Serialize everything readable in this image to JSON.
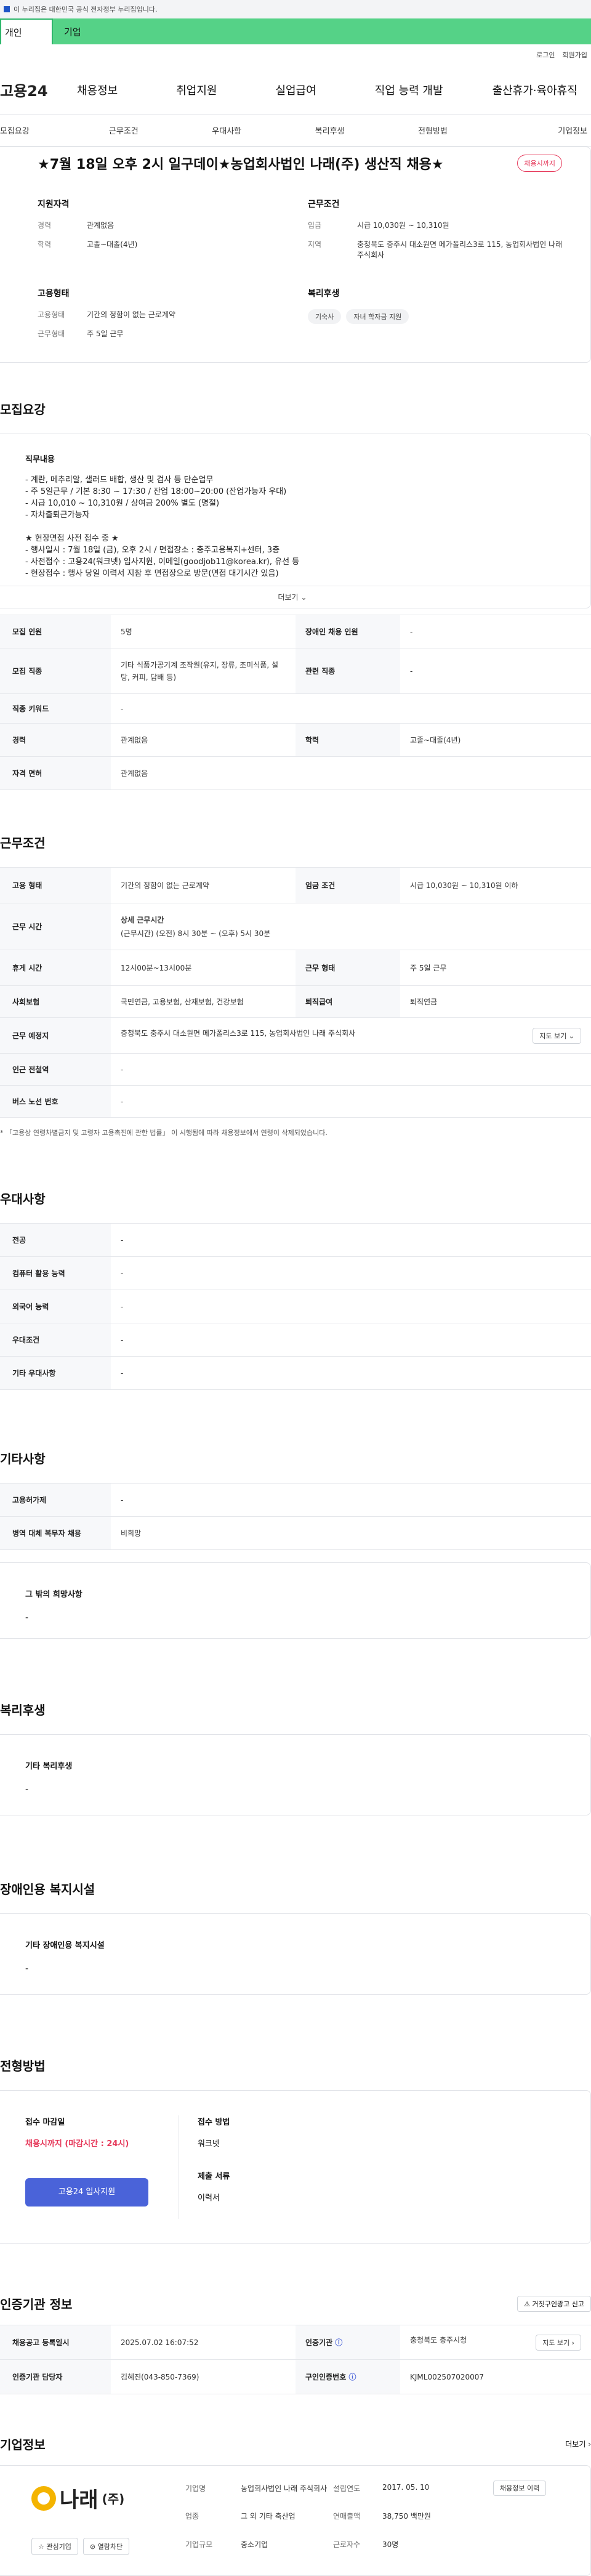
{
  "gov_banner": "이 누리집은 대한민국 공식 전자정부 누리집입니다.",
  "user_type_tabs": [
    "개인",
    "기업"
  ],
  "top_links": [
    "로그인",
    "회원가입"
  ],
  "logo_text": "고용24",
  "main_nav": [
    "채용정보",
    "취업지원",
    "실업급여",
    "직업 능력 개발",
    "출산휴가·육아휴직"
  ],
  "section_tabs": [
    "모집요강",
    "근무조건",
    "우대사항",
    "복리후생",
    "전형방법",
    "기업정보"
  ],
  "job": {
    "title": "★7월 18일 오후 2시 일구데이★농업회사법인 나래(주) 생산직 채용★",
    "status_badge": "채용시까지",
    "qual_title": "지원자격",
    "qual_rows": [
      {
        "k": "경력",
        "v": "관계없음"
      },
      {
        "k": "학력",
        "v": "고졸~대졸(4년)"
      }
    ],
    "work_title": "근무조건",
    "work_rows": [
      {
        "k": "임금",
        "v": "시급 10,030원 ~ 10,310원"
      },
      {
        "k": "지역",
        "v": "충청북도 충주시 대소원면 메가폴리스3로 115, 농업회사법인 나래 주식회사"
      }
    ],
    "emp_title": "고용형태",
    "emp_rows": [
      {
        "k": "고용형태",
        "v": "기간의 정함이 없는 근로계약"
      },
      {
        "k": "근무형태",
        "v": "주 5일 근무"
      }
    ],
    "welfare_title": "복리후생",
    "welfare_chips": [
      "기숙사",
      "자녀 학자금 지원"
    ]
  },
  "recruit": {
    "section_title": "모집요강",
    "duty_title": "직무내용",
    "duty_text": "- 계란, 메추리알, 샐러드 배합, 생산 및 검사 등 단순업무\n- 주 5일근무 / 기본 8:30 ~ 17:30 / 잔업 18:00~20:00 (잔업가능자 우대)\n- 시급 10,010 ~ 10,310원 / 상여금 200% 별도 (명절)\n- 자차출퇴근가능자\n\n★ 현장면접 사전 접수 중 ★\n- 행사일시 : 7월 18일 (금), 오후 2시 / 면접장소 : 충주고용복지+센터, 3층\n- 사전접수 : 고용24(워크넷) 입사지원, 이메일(goodjob11@korea.kr), 유선 등\n- 현장접수 : 행사 당일 이력서 지참 후 면접장으로 방문(면접 대기시간 있음)",
    "more_label": "더보기",
    "rows": [
      {
        "k1": "모집 인원",
        "v1": "5명",
        "k2": "장애인 채용 인원",
        "v2": "-"
      },
      {
        "k1": "모집 직종",
        "v1": "기타 식품가공기계 조작원(유지, 장류, 조미식품, 설탕, 커피, 담배 등)",
        "k2": "관련 직종",
        "v2": "-"
      },
      {
        "k1": "직종 키워드",
        "v1": "-"
      },
      {
        "k1": "경력",
        "v1": "관계없음",
        "k2": "학력",
        "v2": "고졸~대졸(4년)"
      },
      {
        "k1": "자격 면허",
        "v1": "관계없음"
      }
    ]
  },
  "conditions": {
    "section_title": "근무조건",
    "emp_type_k": "고용 형태",
    "emp_type_v": "기간의 정함이 없는 근로계약",
    "wage_k": "임금 조건",
    "wage_v": "시급 10,030원 ~ 10,310원 이하",
    "hours_k": "근무 시간",
    "hours_sub": "상세 근무시간",
    "hours_v": "(근무시간) (오전) 8시 30분 ~ (오후) 5시 30분",
    "break_k": "휴게 시간",
    "break_v": "12시00분~13시00분",
    "form_k": "근무 형태",
    "form_v": "주 5일 근무",
    "insurance_k": "사회보험",
    "insurance_v": "국민연금, 고용보험, 산재보험, 건강보험",
    "severance_k": "퇴직급여",
    "severance_v": "퇴직연금",
    "place_k": "근무 예정지",
    "place_v": "충청북도 충주시 대소원면 메가폴리스3로 115, 농업회사법인 나래 주식회사",
    "map_btn": "지도 보기",
    "subway_k": "인근 전철역",
    "subway_v": "-",
    "bus_k": "버스 노선 번호",
    "bus_v": "-",
    "footnote": "* 「고용상 연령차별금지 및 고령자 고용촉진에 관한 법률」 이 시행됨에 따라 채용정보에서 연령이 삭제되었습니다."
  },
  "preference": {
    "section_title": "우대사항",
    "rows": [
      {
        "k": "전공",
        "v": "-"
      },
      {
        "k": "컴퓨터 활용 능력",
        "v": "-"
      },
      {
        "k": "외국어 능력",
        "v": "-"
      },
      {
        "k": "우대조건",
        "v": "-"
      },
      {
        "k": "기타 우대사항",
        "v": "-"
      }
    ]
  },
  "etc": {
    "section_title": "기타사항",
    "rows": [
      {
        "k": "고용허가제",
        "v": "-"
      },
      {
        "k": "병역 대체 복무자 채용",
        "v": "비희망"
      }
    ],
    "hope_title": "그 밖의 희망사항",
    "hope_v": "-"
  },
  "welfare": {
    "section_title": "복리후생",
    "sub_title": "기타 복리후생",
    "v": "-"
  },
  "disability": {
    "section_title": "장애인용 복지시설",
    "sub_title": "기타 장애인용 복지시설",
    "v": "-"
  },
  "selection": {
    "section_title": "전형방법",
    "deadline_label": "접수 마감일",
    "deadline_v": "채용시까지 (마감시간 : 24시)",
    "apply_btn": "고용24 입사지원",
    "method_label": "접수 방법",
    "method_v": "워크넷",
    "docs_label": "제출 서류",
    "docs_v": "이력서"
  },
  "cert": {
    "section_title": "인증기관 정보",
    "report_btn": "거짓구인광고 신고",
    "reg_date_k": "채용공고 등록일시",
    "reg_date_v": "2025.07.02 16:07:52",
    "agency_k": "인증기관",
    "agency_v": "충청북도 충주시청",
    "map_btn": "지도 보기",
    "manager_k": "인증기관 담당자",
    "manager_v": "김혜진(043-850-7369)",
    "reqno_k": "구인인증번호",
    "reqno_v": "KJML002507020007"
  },
  "company": {
    "section_title": "기업정보",
    "more_label": "더보기",
    "logo_text": "나래",
    "logo_suffix": "(주)",
    "interest_btn": "관심기업",
    "block_btn": "열람차단",
    "history_btn": "채용정보 이력",
    "name_k": "기업명",
    "name_v": "농업회사법인 나래 주식회사",
    "est_k": "설립연도",
    "est_v": "2017. 05. 10",
    "industry_k": "업종",
    "industry_v": "그 외 기타 축산업",
    "sales_k": "연매출액",
    "sales_v": "38,750 백만원",
    "size_k": "기업규모",
    "size_v": "중소기업",
    "staff_k": "근로자수",
    "staff_v": "30명"
  }
}
